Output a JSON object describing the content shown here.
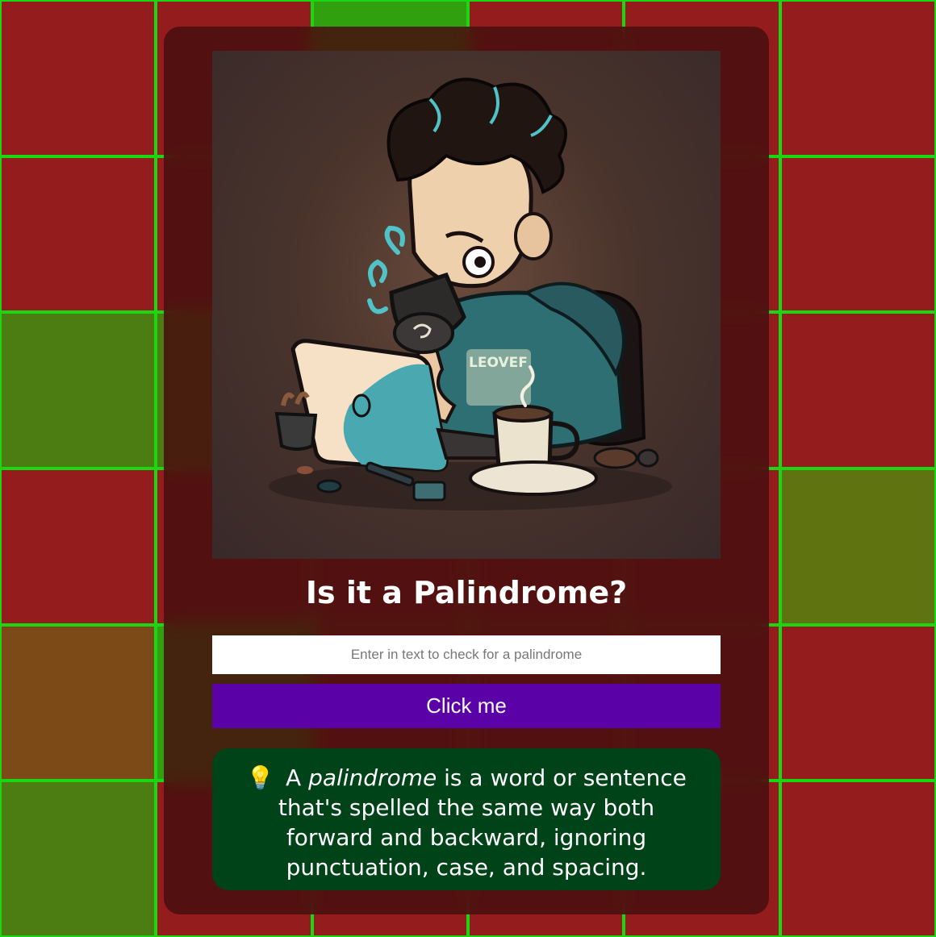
{
  "colors": {
    "tile_red": "#951c1c",
    "tile_olive": "#5f7310",
    "tile_grass": "#4c7d12",
    "tile_brown": "#7b4a16",
    "tile_green": "#30a00e",
    "grid_line": "#19d812",
    "card_bg": "#480e0e",
    "button_bg": "#5a02a8",
    "info_bg": "#004318"
  },
  "hero": {
    "image_icon": "coder-drinking-coffee-illustration",
    "shirt_text": "LEOVEF"
  },
  "title": "Is it a Palindrome?",
  "input": {
    "placeholder": "Enter in text to check for a palindrome",
    "value": ""
  },
  "button_label": "Click me",
  "info": {
    "bulb_icon": "💡",
    "prefix": "A",
    "emphasis": "palindrome",
    "rest": "is a word or sentence that's spelled the same way both forward and backward, ignoring punctuation, case, and spacing."
  }
}
